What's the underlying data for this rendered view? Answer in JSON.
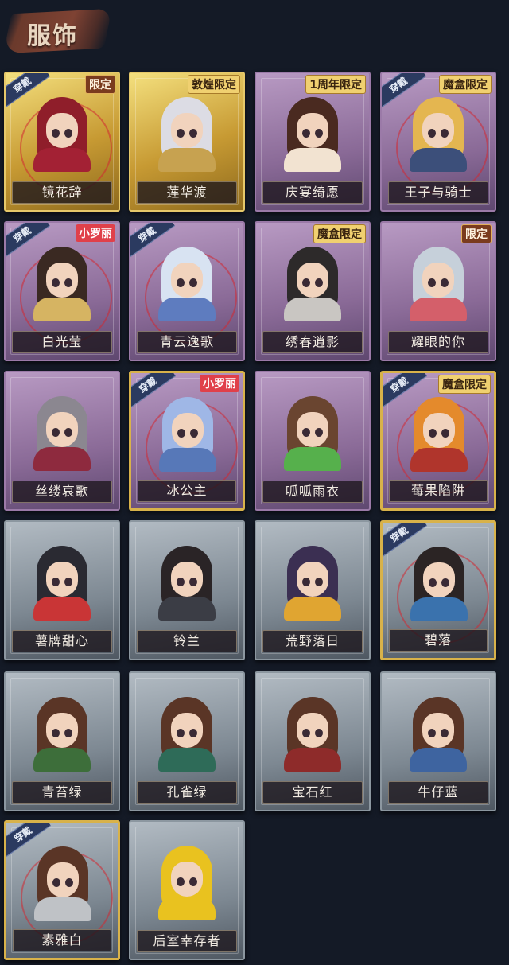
{
  "page": {
    "title": "服饰"
  },
  "labels": {
    "equipped": "穿戴"
  },
  "colors": {
    "gold_frame": "#c79a33",
    "purple_frame": "#8a6a97",
    "gray_frame": "#7d8892",
    "equipped_banner": "#2b3a60",
    "background": "#141a26"
  },
  "costumes": [
    {
      "name": "镜花辞",
      "frame": "gold",
      "equipped": true,
      "tag": "限定",
      "tag_style": "limited",
      "hair": "#8f1e2a",
      "outfit": "#a32134"
    },
    {
      "name": "莲华渡",
      "frame": "gold",
      "equipped": false,
      "tag": "敦煌限定",
      "tag_style": "gold-tag",
      "hair": "#dcdce4",
      "outfit": "#c7a250"
    },
    {
      "name": "庆宴绮愿",
      "frame": "purple",
      "equipped": false,
      "tag": "1周年限定",
      "tag_style": "gold-tag",
      "hair": "#4a2a20",
      "outfit": "#f2e3d1"
    },
    {
      "name": "王子与骑士",
      "frame": "purple",
      "equipped": true,
      "tag": "魔盒限定",
      "tag_style": "gold-tag",
      "hair": "#e4b650",
      "outfit": "#3c4f7a"
    },
    {
      "name": "白光莹",
      "frame": "purple",
      "equipped": true,
      "tag": "小罗丽",
      "tag_style": "red-tag",
      "hair": "#3a2922",
      "outfit": "#d6b462"
    },
    {
      "name": "青云逸歌",
      "frame": "purple",
      "equipped": true,
      "tag": "",
      "tag_style": "",
      "hair": "#d8e3f2",
      "outfit": "#5e7cbf"
    },
    {
      "name": "绣春逍影",
      "frame": "purple",
      "equipped": false,
      "tag": "魔盒限定",
      "tag_style": "gold-tag",
      "hair": "#2d2a2a",
      "outfit": "#c9c6c2"
    },
    {
      "name": "耀眼的你",
      "frame": "purple",
      "equipped": false,
      "tag": "限定",
      "tag_style": "limited",
      "hair": "#c6d0da",
      "outfit": "#d45f6a"
    },
    {
      "name": "丝缕哀歌",
      "frame": "purple",
      "equipped": false,
      "tag": "",
      "tag_style": "",
      "hair": "#8b8790",
      "outfit": "#8e2a3e"
    },
    {
      "name": "冰公主",
      "frame": "purple-gold",
      "equipped": true,
      "tag": "小罗丽",
      "tag_style": "red-tag",
      "hair": "#9fb7e6",
      "outfit": "#5778b8"
    },
    {
      "name": "呱呱雨衣",
      "frame": "purple",
      "equipped": false,
      "tag": "",
      "tag_style": "",
      "hair": "#6a4530",
      "outfit": "#56b04c"
    },
    {
      "name": "莓果陷阱",
      "frame": "purple-gold",
      "equipped": true,
      "tag": "魔盒限定",
      "tag_style": "gold-tag",
      "hair": "#e48a2c",
      "outfit": "#b0352c"
    },
    {
      "name": "薯牌甜心",
      "frame": "gray",
      "equipped": false,
      "tag": "",
      "tag_style": "",
      "hair": "#2a2a32",
      "outfit": "#c93536"
    },
    {
      "name": "铃兰",
      "frame": "gray",
      "equipped": false,
      "tag": "",
      "tag_style": "",
      "hair": "#2a2426",
      "outfit": "#3b3d45"
    },
    {
      "name": "荒野落日",
      "frame": "gray",
      "equipped": false,
      "tag": "",
      "tag_style": "",
      "hair": "#3b2f52",
      "outfit": "#e0a531"
    },
    {
      "name": "碧落",
      "frame": "gray-gold",
      "equipped": true,
      "tag": "",
      "tag_style": "",
      "hair": "#2b2424",
      "outfit": "#3a72ad"
    },
    {
      "name": "青苔绿",
      "frame": "gray",
      "equipped": false,
      "tag": "",
      "tag_style": "",
      "hair": "#5a3526",
      "outfit": "#3d6e3a"
    },
    {
      "name": "孔雀绿",
      "frame": "gray",
      "equipped": false,
      "tag": "",
      "tag_style": "",
      "hair": "#5a3526",
      "outfit": "#2e6b58"
    },
    {
      "name": "宝石红",
      "frame": "gray",
      "equipped": false,
      "tag": "",
      "tag_style": "",
      "hair": "#5a3526",
      "outfit": "#8e2b2a"
    },
    {
      "name": "牛仔蓝",
      "frame": "gray",
      "equipped": false,
      "tag": "",
      "tag_style": "",
      "hair": "#5a3526",
      "outfit": "#3e64a0"
    },
    {
      "name": "素雅白",
      "frame": "gray-gold",
      "equipped": true,
      "tag": "",
      "tag_style": "",
      "hair": "#5a3526",
      "outfit": "#bfc2c6"
    },
    {
      "name": "后室幸存者",
      "frame": "gray",
      "equipped": false,
      "tag": "",
      "tag_style": "",
      "hair": "#e9c21f",
      "outfit": "#e9c21f"
    }
  ]
}
